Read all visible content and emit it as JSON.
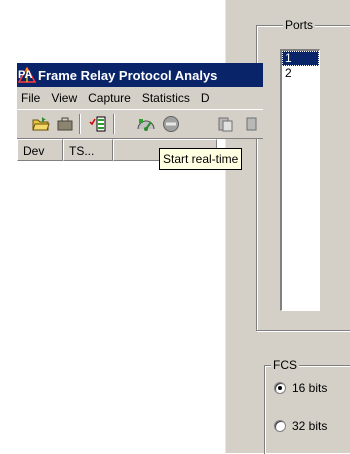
{
  "app": {
    "logo_text": "PA",
    "title": "Frame Relay Protocol Analys",
    "menu": [
      "File",
      "View",
      "Capture",
      "Statistics",
      "D"
    ],
    "toolbar": [
      "open-folder-icon",
      "briefcase-icon",
      "checklist-icon",
      "start-realtime-icon",
      "stop-icon",
      "paste-icon",
      "copy-icon"
    ],
    "columns": [
      "Dev",
      "TS...",
      ""
    ],
    "tooltip": "Start real-time"
  },
  "ports": {
    "title": "Ports",
    "items": [
      "1",
      "2"
    ],
    "selected_index": 0
  },
  "fcs": {
    "title": "FCS",
    "options": [
      {
        "label": "16 bits",
        "checked": true
      },
      {
        "label": "32 bits",
        "checked": false
      }
    ]
  },
  "colors": {
    "selection": "#0a246a",
    "face": "#d4d0c8",
    "tooltip": "#ffffe1"
  }
}
